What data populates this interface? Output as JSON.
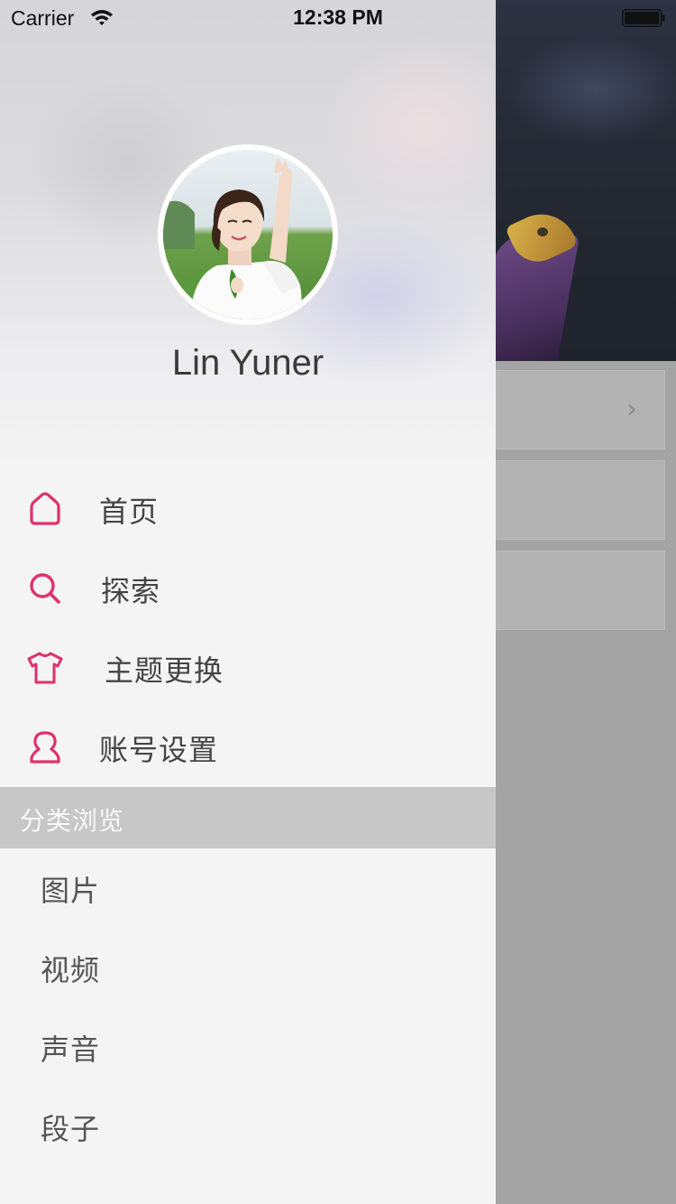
{
  "status_bar": {
    "carrier": "Carrier",
    "time": "12:38 PM"
  },
  "drawer": {
    "user_name": "Lin Yuner",
    "menu": [
      {
        "label": "首页",
        "icon": "home-icon"
      },
      {
        "label": "探索",
        "icon": "search-icon"
      },
      {
        "label": "主题更换",
        "icon": "shirt-icon"
      },
      {
        "label": "账号设置",
        "icon": "user-icon"
      }
    ],
    "section_title": "分类浏览",
    "categories": [
      {
        "label": "图片"
      },
      {
        "label": "视频"
      },
      {
        "label": "声音"
      },
      {
        "label": "段子"
      }
    ]
  },
  "main": {
    "rows": [
      {
        "icon": "chevron-right-icon",
        "chevron": "›"
      },
      {},
      {}
    ]
  },
  "colors": {
    "accent": "#e0316a",
    "section_bg": "#c7c7c7",
    "drawer_bg": "#f4f4f4"
  }
}
